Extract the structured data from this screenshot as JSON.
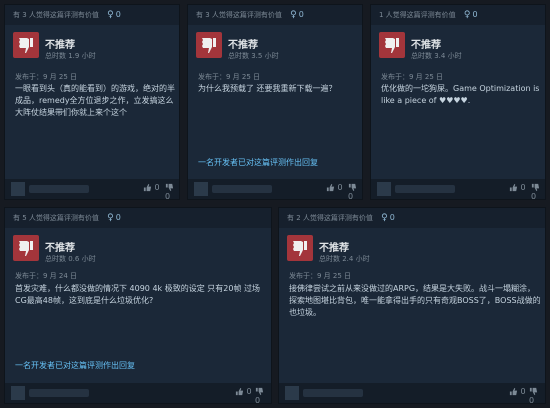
{
  "colors": {
    "accent": "#66c0f4",
    "thumb_bg": "#a3353b",
    "card_bg": "#1b2838"
  },
  "reviews": [
    {
      "helpful": "有 3 人觉得这篇评测有价值",
      "award_icon": "award-icon",
      "award_count": "0",
      "verdict": "不推荐",
      "hours": "总时数 1.9 小时",
      "posted": "发布于：9 月 25 日",
      "body": "一眼看到头（真的能看到）的游戏，绝对的半成品，remedy全方位退步之作，立发搞这么大阵仗结果带们你就上来个这个",
      "dev_reply": "",
      "vote_up": "0",
      "vote_down": "0"
    },
    {
      "helpful": "有 3 人觉得这篇评测有价值",
      "award_icon": "award-icon",
      "award_count": "0",
      "verdict": "不推荐",
      "hours": "总时数 3.5 小时",
      "posted": "发布于：9 月 25 日",
      "body": "为什么我预载了 还要我重新下载一遍？",
      "dev_reply": "一名开发者已对这篇评测作出回复",
      "vote_up": "0",
      "vote_down": "0"
    },
    {
      "helpful": "1 人觉得这篇评测有价值",
      "award_icon": "award-icon",
      "award_count": "0",
      "verdict": "不推荐",
      "hours": "总时数 3.4 小时",
      "posted": "发布于：9 月 25 日",
      "body": "优化做的一坨狗屎。Game Optimization is like a piece of ♥♥♥♥.",
      "dev_reply": "",
      "vote_up": "0",
      "vote_down": "0"
    },
    {
      "helpful": "有 5 人觉得这篇评测有价值",
      "award_icon": "award-icon",
      "award_count": "0",
      "verdict": "不推荐",
      "hours": "总时数 0.6 小时",
      "posted": "发布于：9 月 24 日",
      "body": "首发灾难，什么都没做的情况下 4090 4k 极致的设定 只有20帧 过场CG最高48帧，这到底是什么垃圾优化?",
      "dev_reply": "一名开发者已对这篇评测作出回复",
      "vote_up": "0",
      "vote_down": "0"
    },
    {
      "helpful": "有 2 人觉得这篇评测有价值",
      "award_icon": "award-icon",
      "award_count": "0",
      "verdict": "不推荐",
      "hours": "总时数 2.4 小时",
      "posted": "发布于：9 月 25 日",
      "body": "接佛律尝试之前从来没做过的ARPG，结果是大失败。战斗一塌糊涂，探索地图堪比背包，唯一能拿得出手的只有奇观BOSS了，BOSS战做的也垃圾。",
      "dev_reply": "",
      "vote_up": "0",
      "vote_down": "0"
    }
  ]
}
